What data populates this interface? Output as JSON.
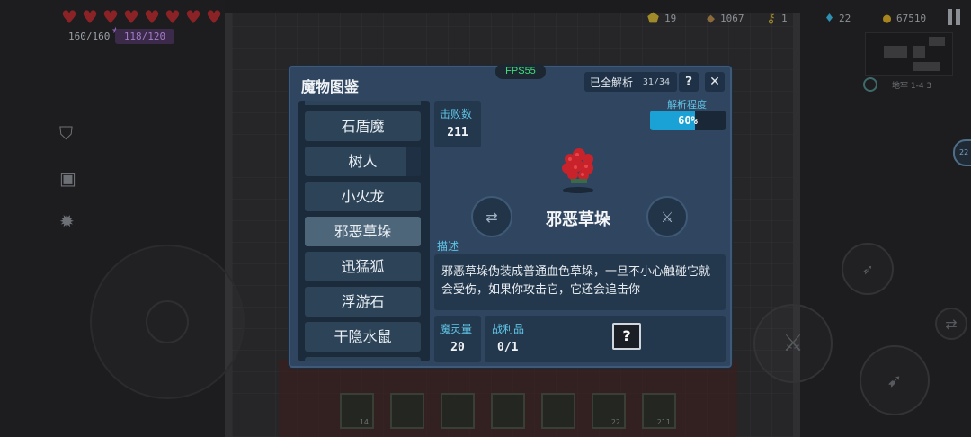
{
  "hud": {
    "hearts": [
      "♥",
      "♥",
      "♥",
      "♥",
      "♥",
      "♥",
      "♥",
      "♥"
    ],
    "hp": "160/160",
    "mana": "118/120",
    "resources": [
      {
        "icon": "gem-pentagon-icon",
        "glyph": "⬟",
        "value": "19",
        "color": "#a08a2a"
      },
      {
        "icon": "material-icon",
        "glyph": "◆",
        "value": "1067",
        "color": "#8a6a3a"
      },
      {
        "icon": "key-icon",
        "glyph": "⚷",
        "value": "1",
        "color": "#a08a2a"
      },
      {
        "icon": "diamond-icon",
        "glyph": "♦",
        "value": "22",
        "color": "#2f8fb0"
      },
      {
        "icon": "coin-icon",
        "glyph": "●",
        "value": "67510",
        "color": "#a8841e"
      }
    ],
    "floor": "地牢 1-4 3"
  },
  "modal": {
    "title": "魔物图鉴",
    "fps": "FPS55",
    "analyzed_label": "已全解析",
    "analyzed_count": "31/34",
    "help": "?",
    "close": "✕"
  },
  "monster_list": [
    {
      "name": "石盾魔"
    },
    {
      "name": "树人"
    },
    {
      "name": "小火龙"
    },
    {
      "name": "邪恶草垛"
    },
    {
      "name": "迅猛狐"
    },
    {
      "name": "浮游石"
    },
    {
      "name": "干隐水鼠"
    }
  ],
  "selected_index": 3,
  "detail": {
    "kills_label": "击败数",
    "kills": "211",
    "progress_label": "解析程度",
    "progress": 0.6,
    "progress_text": "60%",
    "name": "邪恶草垛",
    "prev_icon": "⇄",
    "next_icon": "⚔",
    "desc_label": "描述",
    "description": "邪恶草垛伪装成普通血色草垛，一旦不小心触碰它就会受伤，如果你攻击它，它还会追击你",
    "soul_label": "魔灵量",
    "soul": "20",
    "loot_label": "战利品",
    "loot": "0/1",
    "loot_unknown": "?"
  },
  "hotbar": [
    "14",
    "",
    "",
    "",
    "",
    "22",
    "211"
  ],
  "colors": {
    "panel": "#2f4560",
    "accent_label": "#5fc6e8",
    "progress_fill": "#1aa2d6",
    "fps_green": "#3fe07a"
  }
}
